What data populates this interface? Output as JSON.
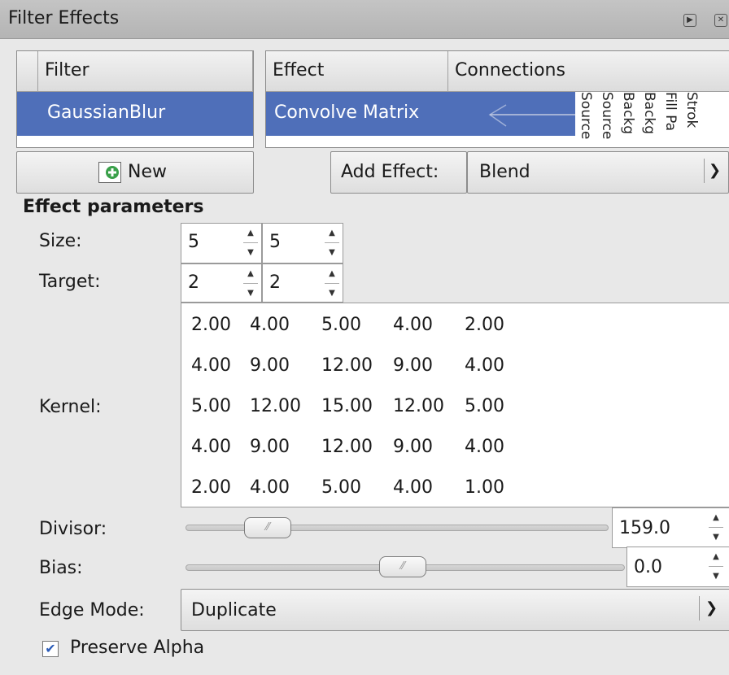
{
  "window": {
    "title": "Filter Effects"
  },
  "filter_list": {
    "header": "Filter",
    "items": [
      "GaussianBlur"
    ],
    "new_button": "New"
  },
  "effect_list": {
    "header_effect": "Effect",
    "header_connections": "Connections",
    "items": [
      "Convolve Matrix"
    ],
    "connection_inputs": [
      "Source",
      "Source",
      "Backg",
      "Backg",
      "Fill Pa",
      "Strok"
    ]
  },
  "add_effect": {
    "label": "Add Effect:",
    "value": "Blend"
  },
  "params": {
    "heading": "Effect parameters",
    "size_label": "Size:",
    "size_x": "5",
    "size_y": "5",
    "target_label": "Target:",
    "target_x": "2",
    "target_y": "2",
    "kernel_label": "Kernel:",
    "kernel": [
      [
        "2.00",
        "4.00",
        "5.00",
        "4.00",
        "2.00"
      ],
      [
        "4.00",
        "9.00",
        "12.00",
        "9.00",
        "4.00"
      ],
      [
        "5.00",
        "12.00",
        "15.00",
        "12.00",
        "5.00"
      ],
      [
        "4.00",
        "9.00",
        "12.00",
        "9.00",
        "4.00"
      ],
      [
        "2.00",
        "4.00",
        "5.00",
        "4.00",
        "1.00"
      ]
    ],
    "divisor_label": "Divisor:",
    "divisor_value": "159.0",
    "bias_label": "Bias:",
    "bias_value": "0.0",
    "edge_mode_label": "Edge Mode:",
    "edge_mode_value": "Duplicate",
    "preserve_alpha_label": "Preserve Alpha",
    "preserve_alpha_checked": true
  },
  "colors": {
    "selection": "#4f6fb9",
    "background": "#e8e8e8"
  }
}
